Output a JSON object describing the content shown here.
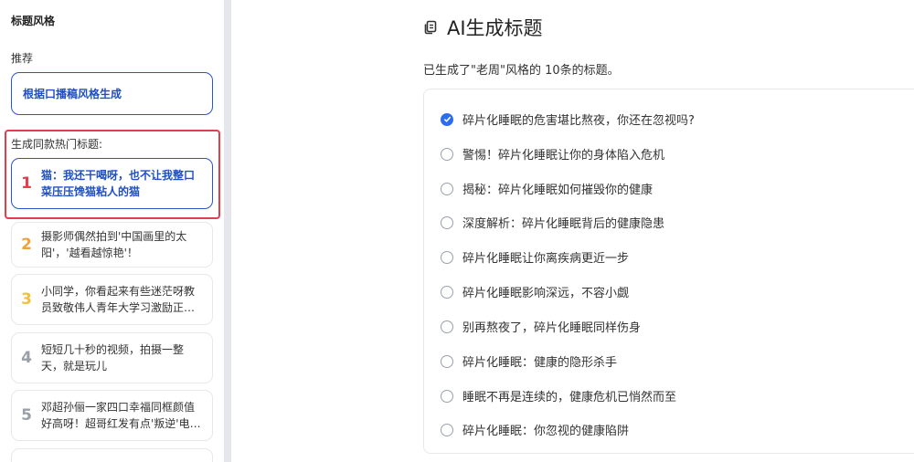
{
  "sidebar": {
    "title": "标题风格",
    "recommend_label": "推荐",
    "generate_button": "根据口播稿风格生成",
    "hot_label": "生成同款热门标题:",
    "items": [
      {
        "num": "1",
        "text": "猫：我还干喝呀，也不让我整口菜压压馋猫粘人的猫",
        "color": "#e0404a"
      },
      {
        "num": "2",
        "text": "摄影师偶然拍到'中国画里的太阳'，'越看越惊艳'！",
        "color": "#f0a23a"
      },
      {
        "num": "3",
        "text": "小同学，你看起来有些迷茫呀教员致敬伟人青年大学习激励正…",
        "color": "#f0c040"
      },
      {
        "num": "4",
        "text": "短短几十秒的视频，拍摄一整天，就是玩儿",
        "color": "#9aa0aa"
      },
      {
        "num": "5",
        "text": "邓超孙俪一家四口幸福同框颜值好高呀！超哥红发有点'叛逆'电…",
        "color": "#9aa0aa"
      }
    ]
  },
  "main": {
    "title": "AI生成标题",
    "subtitle": "已生成了\"老周\"风格的 10条的标题。",
    "options": [
      {
        "text": "碎片化睡眠的危害堪比熬夜，你还在忽视吗?",
        "checked": true
      },
      {
        "text": "警惕！碎片化睡眠让你的身体陷入危机",
        "checked": false
      },
      {
        "text": "揭秘：碎片化睡眠如何摧毁你的健康",
        "checked": false
      },
      {
        "text": "深度解析：碎片化睡眠背后的健康隐患",
        "checked": false
      },
      {
        "text": "碎片化睡眠让你离疾病更近一步",
        "checked": false
      },
      {
        "text": "碎片化睡眠影响深远，不容小觑",
        "checked": false
      },
      {
        "text": "别再熬夜了，碎片化睡眠同样伤身",
        "checked": false
      },
      {
        "text": "碎片化睡眠：健康的隐形杀手",
        "checked": false
      },
      {
        "text": "睡眠不再是连续的，健康危机已悄然而至",
        "checked": false
      },
      {
        "text": "碎片化睡眠：你忽视的健康陷阱",
        "checked": false
      }
    ]
  }
}
